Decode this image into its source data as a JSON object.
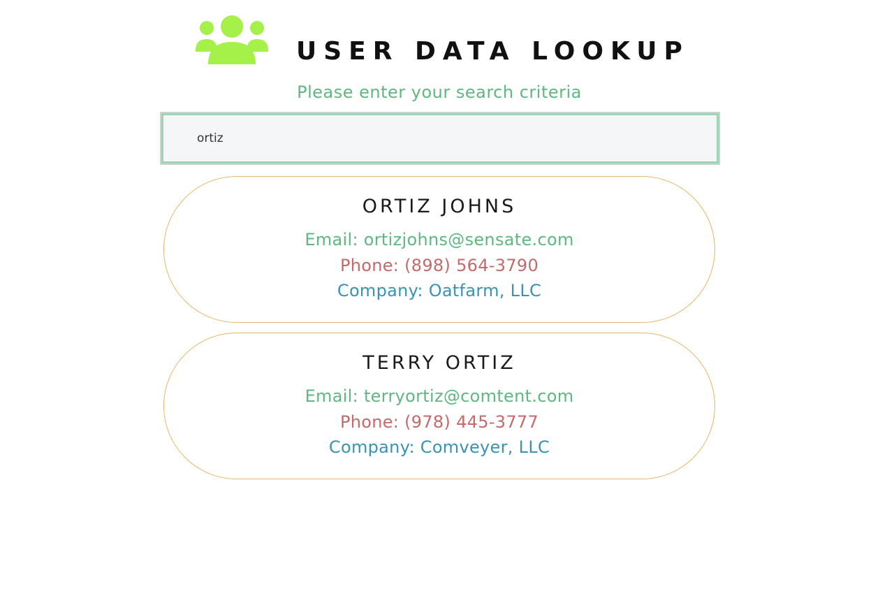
{
  "header": {
    "title": "USER DATA LOOKUP",
    "logo_icon": "users-icon",
    "logo_color": "#a6f04a"
  },
  "search": {
    "prompt": "Please enter your search criteria",
    "value": "ortiz",
    "placeholder": ""
  },
  "colors": {
    "email": "#5fb87f",
    "phone": "#c46a6a",
    "company": "#3a93b3",
    "card_border": "#e2b86a"
  },
  "results": [
    {
      "name": "ORTIZ JOHNS",
      "email": "Email: ortizjohns@sensate.com",
      "phone": "Phone: (898) 564-3790",
      "company": "Company: Oatfarm, LLC"
    },
    {
      "name": "TERRY ORTIZ",
      "email": "Email: terryortiz@comtent.com",
      "phone": "Phone: (978) 445-3777",
      "company": "Company: Comveyer, LLC"
    }
  ]
}
